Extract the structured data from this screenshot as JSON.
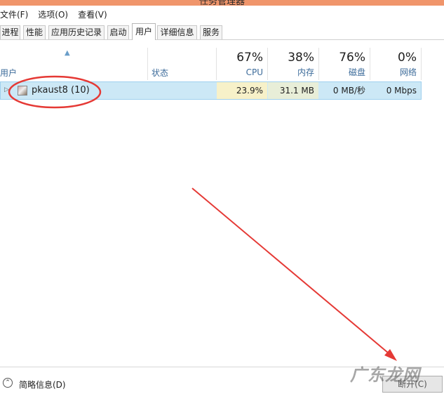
{
  "window": {
    "title": "任务管理器"
  },
  "menu": [
    {
      "label": "文件(F)"
    },
    {
      "label": "选项(O)"
    },
    {
      "label": "查看(V)"
    }
  ],
  "tabs": [
    {
      "label": "进程",
      "active": false
    },
    {
      "label": "性能",
      "active": false
    },
    {
      "label": "应用历史记录",
      "active": false
    },
    {
      "label": "启动",
      "active": false
    },
    {
      "label": "用户",
      "active": true
    },
    {
      "label": "详细信息",
      "active": false
    },
    {
      "label": "服务",
      "active": false
    }
  ],
  "columns": {
    "user": "用户",
    "status": "状态",
    "cpu": {
      "percent": "67%",
      "label": "CPU"
    },
    "memory": {
      "percent": "38%",
      "label": "内存"
    },
    "disk": {
      "percent": "76%",
      "label": "磁盘"
    },
    "network": {
      "percent": "0%",
      "label": "网络"
    }
  },
  "rows": [
    {
      "user": "pkaust8 (10)",
      "status": "",
      "cpu": "23.9%",
      "memory": "31.1 MB",
      "disk": "0 MB/秒",
      "network": "0 Mbps"
    }
  ],
  "footer": {
    "brief_label": "简略信息(D)",
    "disconnect_label": "断开(C)"
  },
  "watermark": "广东龙网",
  "colors": {
    "titlebar": "#f0956b",
    "selection": "#cce8f6",
    "annotation": "#e53935"
  }
}
